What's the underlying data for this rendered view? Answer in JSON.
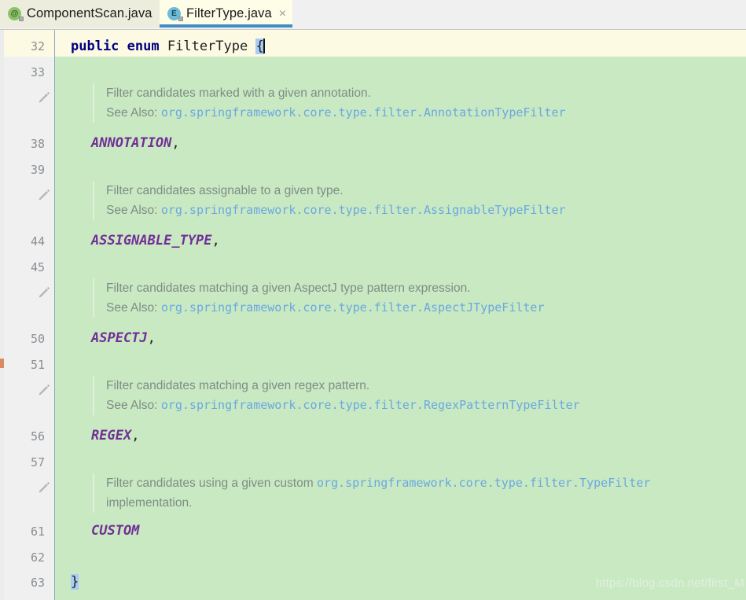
{
  "tabs": [
    {
      "label": "ComponentScan.java",
      "icon": "annotation-icon",
      "icon_glyph": "@",
      "close": "×",
      "active": false
    },
    {
      "label": "FilterType.java",
      "icon": "enum-icon",
      "icon_glyph": "E",
      "close": "×",
      "active": true
    }
  ],
  "colors": {
    "tab_active_bg": "#fdfde8",
    "tab_inactive_bg": "#eceddc",
    "tab_underline": "#3f8dc4",
    "editor_bg": "#c9e9c3",
    "gutter_bg": "#f0f0f0",
    "caret_line_bg": "#fdfae4",
    "keyword": "#00007f",
    "enum_constant": "#722f96",
    "doc_text": "#7e8c84",
    "doc_link": "#6aa8e0",
    "brace_highlight": "#a8cdf5",
    "status_mark": "#d98a62"
  },
  "gutter": {
    "line_numbers": [
      "32",
      "33",
      "38",
      "39",
      "44",
      "45",
      "50",
      "51",
      "56",
      "57",
      "61",
      "62",
      "63"
    ],
    "edit_icon": "pencil-icon",
    "edit_icon_count": 5
  },
  "code": {
    "declaration": {
      "keyword1": "public",
      "keyword2": "enum",
      "type_name": "FilterType",
      "open_brace": "{"
    },
    "close_brace": "}",
    "entries": [
      {
        "doc_text": "Filter candidates marked with a given annotation.",
        "see_also_label": "See Also:",
        "see_also_link": "org.springframework.core.type.filter.AnnotationTypeFilter",
        "constant": "ANNOTATION",
        "separator": ","
      },
      {
        "doc_text": "Filter candidates assignable to a given type.",
        "see_also_label": "See Also:",
        "see_also_link": "org.springframework.core.type.filter.AssignableTypeFilter",
        "constant": "ASSIGNABLE_TYPE",
        "separator": ","
      },
      {
        "doc_text": "Filter candidates matching a given AspectJ type pattern expression.",
        "see_also_label": "See Also:",
        "see_also_link": "org.springframework.core.type.filter.AspectJTypeFilter",
        "constant": "ASPECTJ",
        "separator": ","
      },
      {
        "doc_text": "Filter candidates matching a given regex pattern.",
        "see_also_label": "See Also:",
        "see_also_link": "org.springframework.core.type.filter.RegexPatternTypeFilter",
        "constant": "REGEX",
        "separator": ","
      },
      {
        "doc_text_before": "Filter candidates using a given custom ",
        "doc_inline_link": "org.springframework.core.type.filter.TypeFilter",
        "doc_text_after": "implementation.",
        "constant": "CUSTOM",
        "separator": ""
      }
    ]
  },
  "watermark": "https://blog.csdn.net/first_M"
}
